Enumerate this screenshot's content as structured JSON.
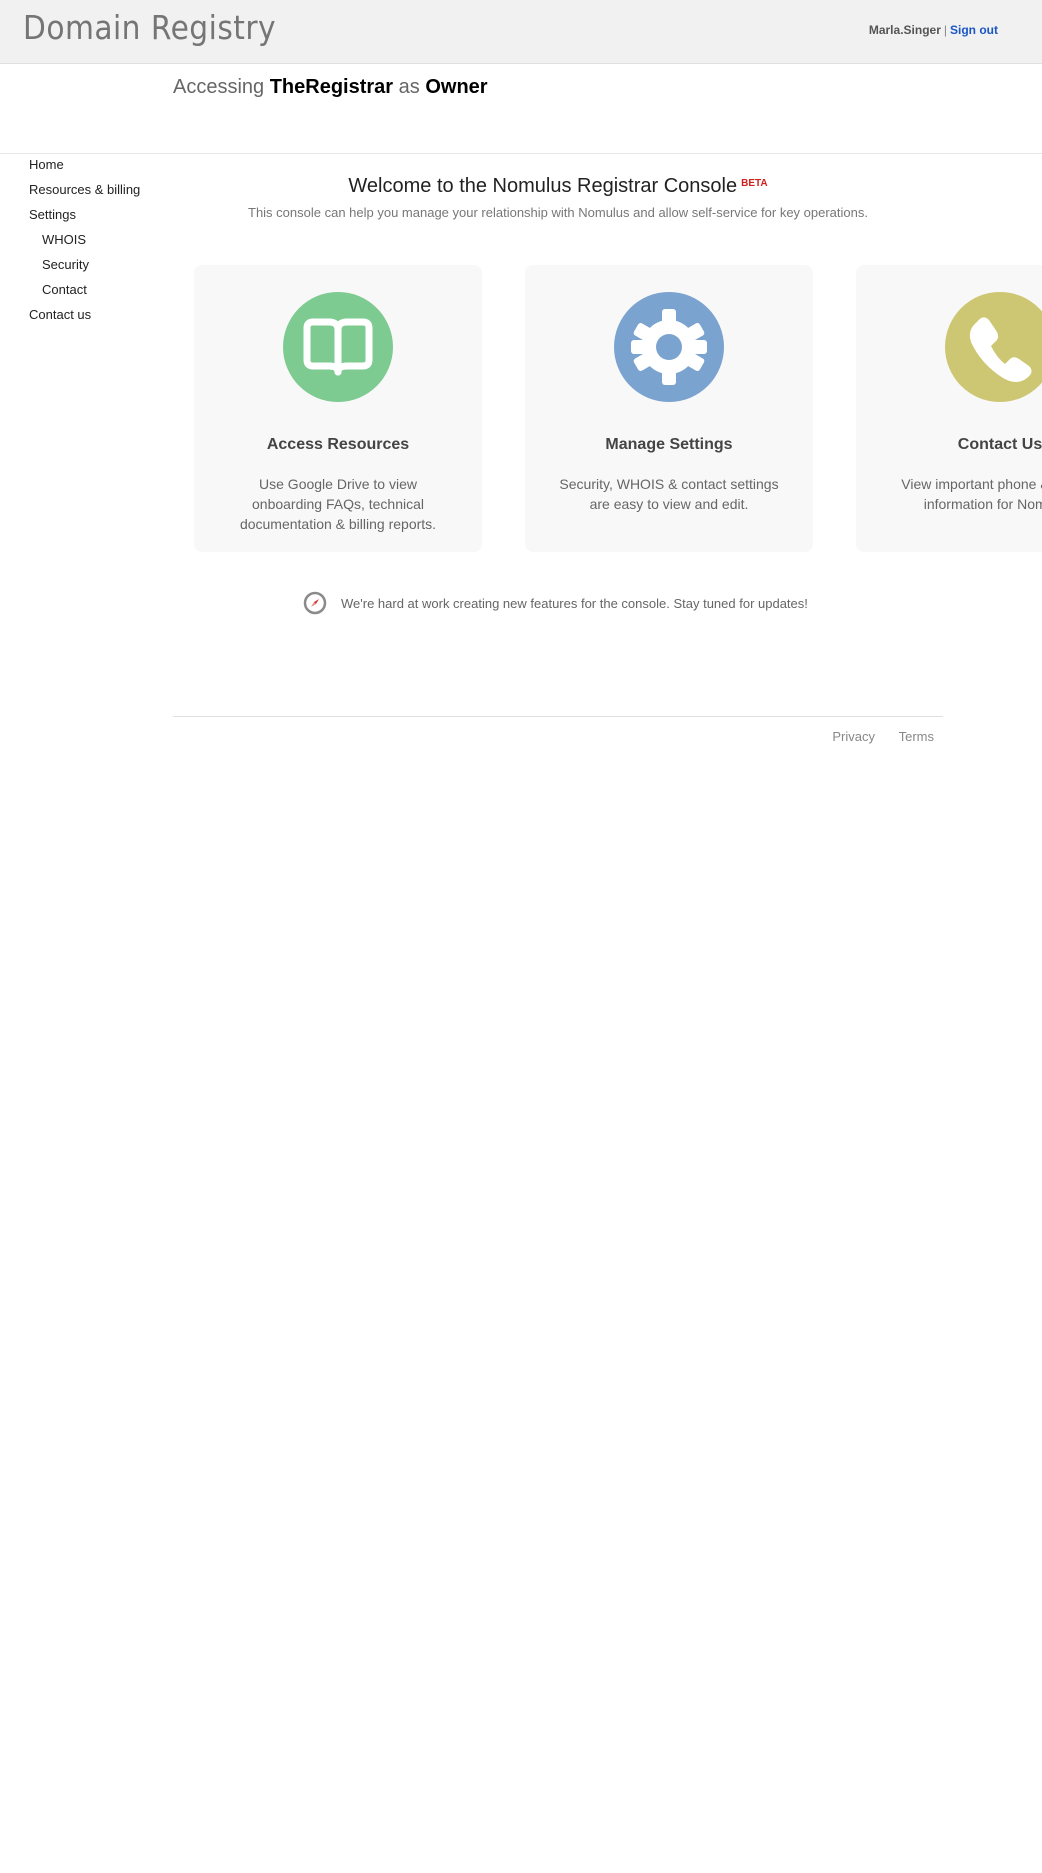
{
  "header": {
    "logo": "Domain Registry",
    "username": "Marla.Singer",
    "separator": "|",
    "sign_out": "Sign out"
  },
  "access": {
    "prefix": "Accessing",
    "registrar": "TheRegistrar",
    "as": "as",
    "role": "Owner"
  },
  "nav": {
    "items": [
      {
        "label": "Home"
      },
      {
        "label": "Resources & billing"
      },
      {
        "label": "Settings"
      },
      {
        "label": "WHOIS"
      },
      {
        "label": "Security"
      },
      {
        "label": "Contact"
      },
      {
        "label": "Contact us"
      }
    ]
  },
  "main": {
    "title": "Welcome to the Nomulus Registrar Console",
    "beta": "BETA",
    "subtitle": "This console can help you manage your relationship with Nomulus and allow self-service for key operations.",
    "cards": [
      {
        "title": "Access Resources",
        "text": "Use Google Drive to view onboarding FAQs, technical documentation & billing reports.",
        "icon": "book-icon",
        "color": "#7dcb91"
      },
      {
        "title": "Manage Settings",
        "text": "Security, WHOIS & contact settings are easy to view and edit.",
        "icon": "gear-icon",
        "color": "#7ba3cf"
      },
      {
        "title": "Contact Us",
        "text": "View important phone & contact information for Nomulus.",
        "icon": "phone-icon",
        "color": "#cdc672"
      }
    ],
    "notice": "We're hard at work creating new features for the console. Stay tuned for updates!"
  },
  "footer": {
    "privacy": "Privacy",
    "terms": "Terms"
  }
}
